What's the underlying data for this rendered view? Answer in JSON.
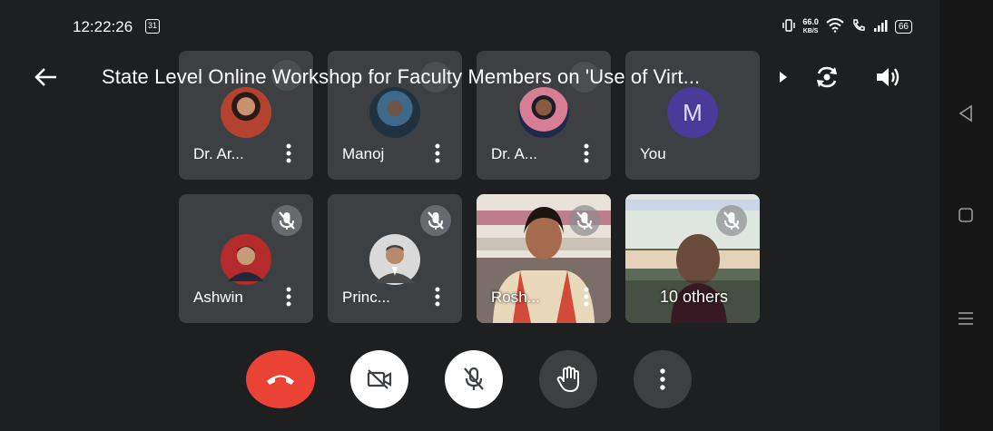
{
  "status_bar": {
    "time": "12:22:26",
    "calendar_day": "31",
    "network_speed_value": "66.0",
    "network_speed_unit": "KB/S",
    "battery": "66"
  },
  "header": {
    "title": "State Level Online Workshop for Faculty Members on 'Use  of Virt..."
  },
  "participants": [
    {
      "name": "Dr. Ar..."
    },
    {
      "name": "Manoj"
    },
    {
      "name": "Dr. A..."
    },
    {
      "name": "You",
      "initial": "M"
    },
    {
      "name": "Ashwin"
    },
    {
      "name": "Princ..."
    },
    {
      "name": "Rosh..."
    },
    {
      "name": "10 others"
    }
  ],
  "colors": {
    "background": "#1e1f21",
    "tile": "#3c4043",
    "end_call": "#ea4335",
    "control_dark": "#3c4043",
    "control_light": "#ffffff",
    "avatar_you": "#4a3a9a"
  },
  "icons": {
    "back": "arrow-left-icon",
    "switch_camera": "switch-camera-icon",
    "speaker": "speaker-icon",
    "end_call": "phone-hangup-icon",
    "camera_off": "camera-off-icon",
    "mic_off": "mic-off-icon",
    "raise_hand": "hand-icon",
    "more": "more-vert-icon"
  }
}
